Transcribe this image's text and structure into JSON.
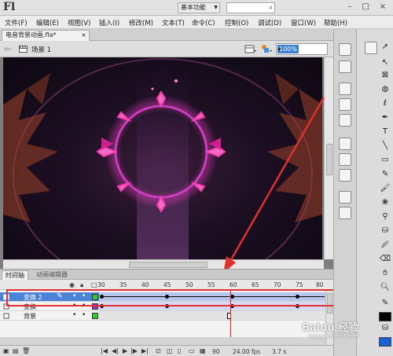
{
  "app": {
    "logo": "Fl",
    "workspace": "基本功能",
    "window_buttons": [
      "–",
      "□",
      "×"
    ]
  },
  "menu": [
    "文件(F)",
    "编辑(E)",
    "视图(V)",
    "插入(I)",
    "修改(M)",
    "文本(T)",
    "命令(C)",
    "控制(O)",
    "调试(D)",
    "窗口(W)",
    "帮助(H)"
  ],
  "document": {
    "tab_label": "电音背景动画.fla*",
    "close": "×"
  },
  "scene": {
    "label": "场景 1",
    "zoom": "100%"
  },
  "timeline": {
    "tabs": [
      "时间轴",
      "动画编辑器"
    ],
    "frame_numbers": [
      "30",
      "35",
      "40",
      "45",
      "50",
      "55",
      "60",
      "65",
      "70",
      "75",
      "80"
    ],
    "layers": [
      {
        "name": "变换 2",
        "selected": true,
        "color": "#33cc33",
        "type": "tween"
      },
      {
        "name": "变换",
        "selected": false,
        "color": "#9933cc",
        "type": "tween"
      },
      {
        "name": "背景",
        "selected": false,
        "color": "#33cc33",
        "type": "static"
      }
    ],
    "footer": {
      "frame": "90",
      "fps": "24.00 fps",
      "time": "3.7 s"
    }
  },
  "watermark": {
    "text": "Baidu 经验",
    "sub": "jingyan.baidu.com"
  },
  "colors": {
    "highlight": "#e03030",
    "selected_layer": "#4b83d6",
    "tween_fill": "#d7d7f3",
    "stroke_swatch": "#000000",
    "fill_swatch": "#1a5fd6"
  }
}
